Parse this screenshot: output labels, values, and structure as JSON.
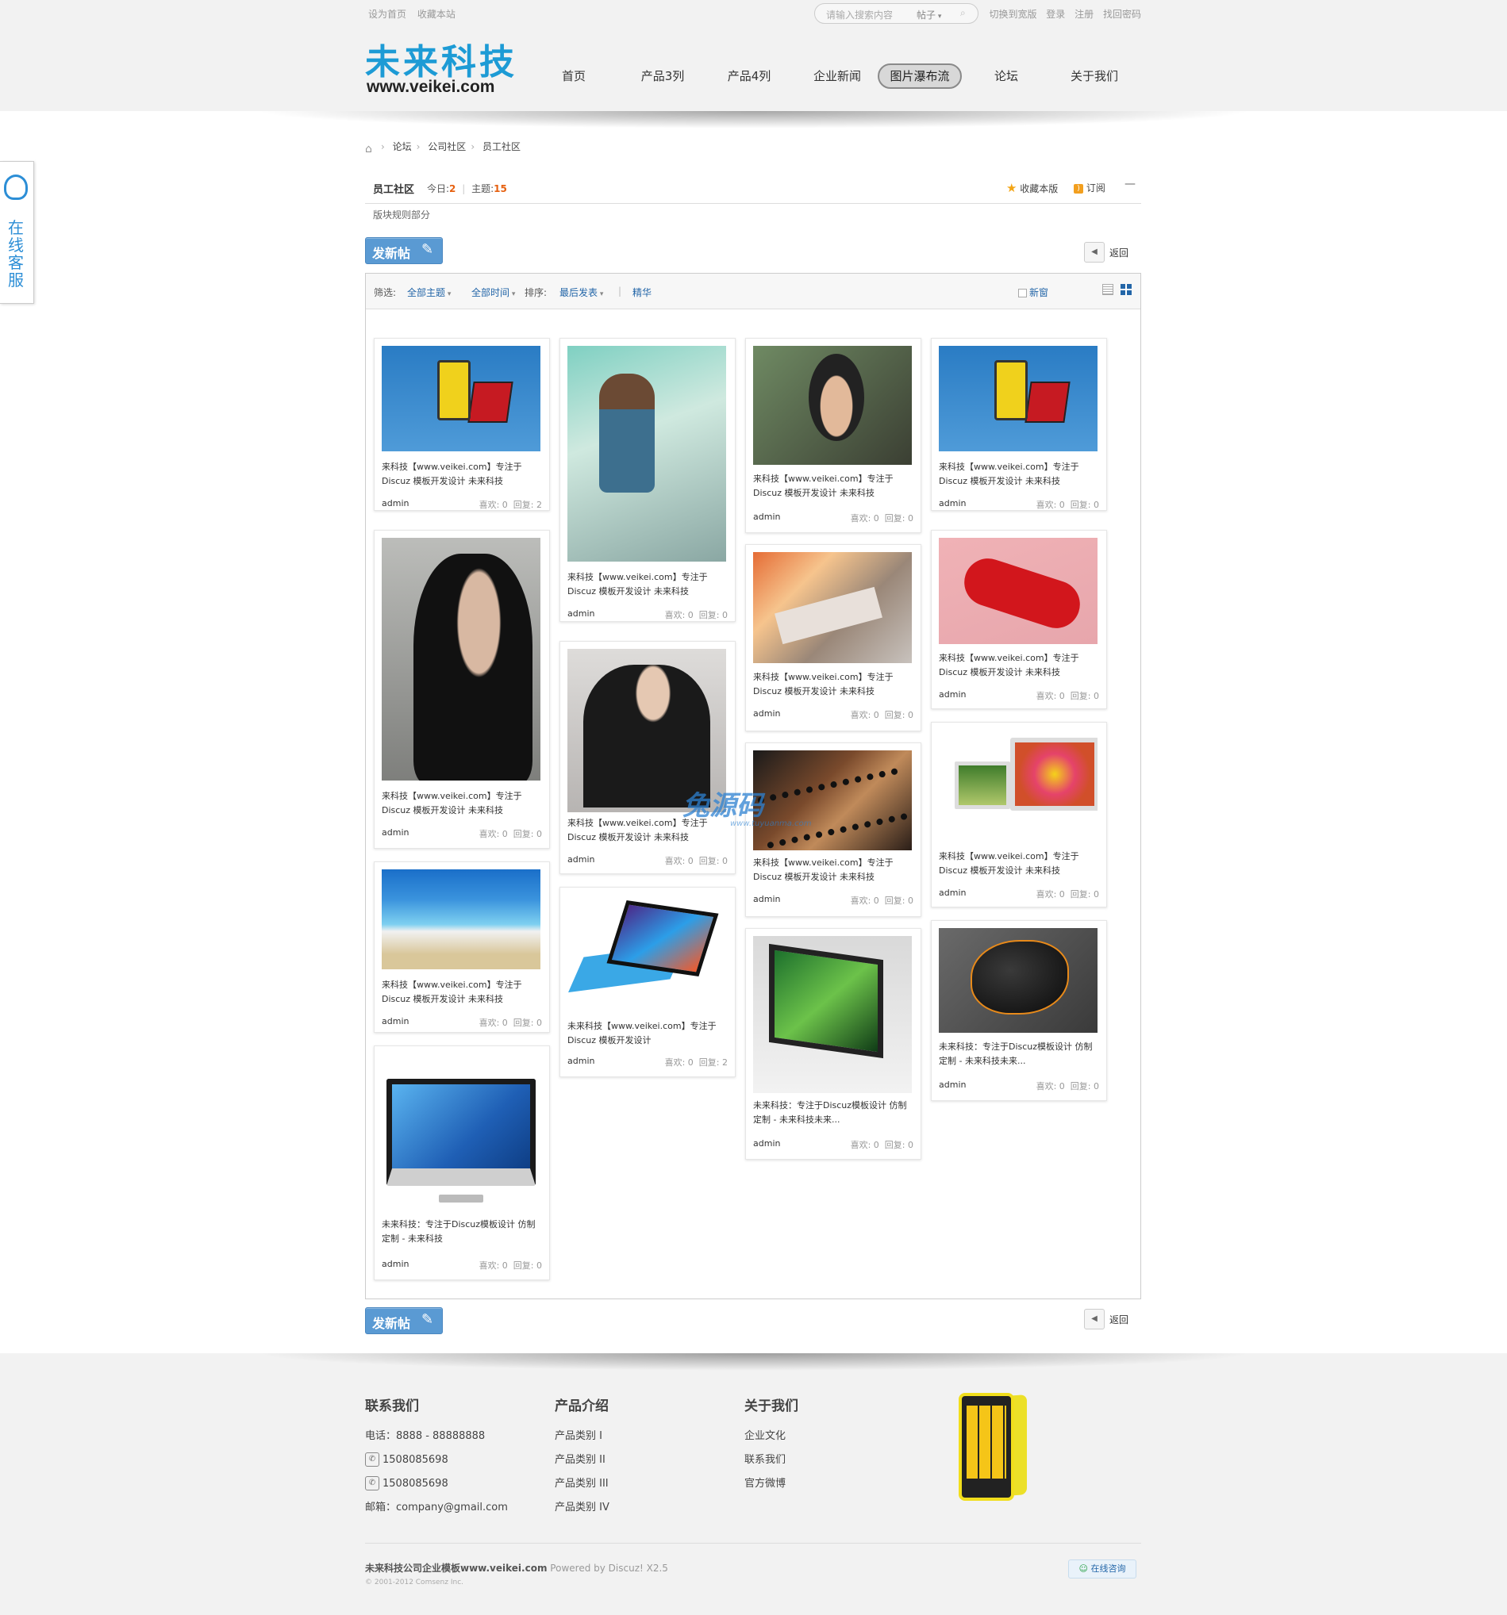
{
  "topbar": {
    "set_home": "设为首页",
    "bookmark": "收藏本站",
    "search_placeholder": "请输入搜索内容",
    "search_type": "帖子",
    "switch_width": "切换到宽版",
    "login": "登录",
    "register": "注册",
    "find_password": "找回密码"
  },
  "logo": {
    "cn": "未来科技",
    "en": "www.veikei.com"
  },
  "nav": [
    {
      "label": "首页"
    },
    {
      "label": "产品3列"
    },
    {
      "label": "产品4列"
    },
    {
      "label": "企业新闻"
    },
    {
      "label": "图片瀑布流",
      "active": true
    },
    {
      "label": "论坛"
    },
    {
      "label": "关于我们"
    }
  ],
  "side_service": {
    "label": "在线客服",
    "icon": "qq-icon"
  },
  "breadcrumb": [
    "论坛",
    "公司社区",
    "员工社区"
  ],
  "forum": {
    "name": "员工社区",
    "today_label": "今日:",
    "today": "2",
    "topics_label": "主题:",
    "topics": "15",
    "favorite": "收藏本版",
    "subscribe": "订阅",
    "rules": "版块规则部分"
  },
  "actions": {
    "new_post": "发新帖",
    "back": "返回"
  },
  "filter": {
    "label": "筛选:",
    "all_topics": "全部主题",
    "all_time": "全部时间",
    "sort_label": "排序:",
    "sort_value": "最后发表",
    "digest": "精华",
    "new_window": "新窗"
  },
  "cards": [
    {
      "image": "phone-lumia",
      "title": "来科技【www.veikei.com】专注于Discuz 模板开发设计 未来科技",
      "author": "admin",
      "likes": "喜欢: 0",
      "replies": "回复: 2"
    },
    {
      "image": "girl-kitchen",
      "title": "来科技【www.veikei.com】专注于Discuz 模板开发设计 未来科技",
      "author": "admin",
      "likes": "喜欢: 0",
      "replies": "回复: 0"
    },
    {
      "image": "boy-portrait",
      "title": "来科技【www.veikei.com】专注于Discuz 模板开发设计 未来科技",
      "author": "admin",
      "likes": "喜欢: 0",
      "replies": "回复: 0"
    },
    {
      "image": "phone-lumia",
      "title": "来科技【www.veikei.com】专注于Discuz 模板开发设计 未来科技",
      "author": "admin",
      "likes": "喜欢: 0",
      "replies": "回复: 0"
    },
    {
      "image": "boy-black-shirt",
      "title": "来科技【www.veikei.com】专注于Discuz 模板开发设计 未来科技",
      "author": "admin",
      "likes": "喜欢: 0",
      "replies": "回复: 0"
    },
    {
      "image": "boy-suit",
      "title": "来科技【www.veikei.com】专注于Discuz 模板开发设计 未来科技",
      "author": "admin",
      "likes": "喜欢: 0",
      "replies": "回复: 0"
    },
    {
      "image": "girl-sunset",
      "title": "来科技【www.veikei.com】专注于Discuz 模板开发设计 未来科技",
      "author": "admin",
      "likes": "喜欢: 0",
      "replies": "回复: 0"
    },
    {
      "image": "boy-red",
      "title": "来科技【www.veikei.com】专注于Discuz 模板开发设计 未来科技",
      "author": "admin",
      "likes": "喜欢: 0",
      "replies": "回复: 0"
    },
    {
      "image": "film-strip",
      "title": "来科技【www.veikei.com】专注于Discuz 模板开发设计 未来科技",
      "author": "admin",
      "likes": "喜欢: 0",
      "replies": "回复: 0"
    },
    {
      "image": "imacs",
      "title": "来科技【www.veikei.com】专注于Discuz 模板开发设计 未来科技",
      "author": "admin",
      "likes": "喜欢: 0",
      "replies": "回复: 0"
    },
    {
      "image": "sea-beach",
      "title": "来科技【www.veikei.com】专注于Discuz 模板开发设计 未来科技",
      "author": "admin",
      "likes": "喜欢: 0",
      "replies": "回复: 0"
    },
    {
      "image": "tablet-surface",
      "title": "未来科技【www.veikei.com】专注于Discuz 模板开发设计",
      "author": "admin",
      "likes": "喜欢: 0",
      "replies": "回复: 2"
    },
    {
      "image": "all-in-one-pc",
      "title": "未来科技：专注于Discuz模板设计 仿制定制 - 未来科技未来...",
      "author": "admin",
      "likes": "喜欢: 0",
      "replies": "回复: 0"
    },
    {
      "image": "gaming-mouse",
      "title": "未来科技：专注于Discuz模板设计 仿制定制 - 未来科技未来...",
      "author": "admin",
      "likes": "喜欢: 0",
      "replies": "回复: 0"
    },
    {
      "image": "imac",
      "title": "未来科技：专注于Discuz模板设计 仿制定制 - 未来科技",
      "author": "admin",
      "likes": "喜欢: 0",
      "replies": "回复: 0"
    }
  ],
  "watermark": {
    "text": "兔源码",
    "sub": "www.tuyuanma.com"
  },
  "footer": {
    "contact": {
      "title": "联系我们",
      "phone": "电话：8888 - 88888888",
      "qq1": "1508085698",
      "qq2": "1508085698",
      "email": "邮箱：company@gmail.com"
    },
    "products": {
      "title": "产品介绍",
      "items": [
        "产品类别 I",
        "产品类别 II",
        "产品类别 III",
        "产品类别 IV"
      ]
    },
    "about": {
      "title": "关于我们",
      "items": [
        "企业文化",
        "联系我们",
        "官方微博"
      ]
    },
    "copyright_site": "未来科技公司企业模板www.veikei.com",
    "powered": "Powered by Discuz! X2.5",
    "copyright2": "© 2001-2012 Comsenz Inc.",
    "online_chat": "在线咨询"
  }
}
